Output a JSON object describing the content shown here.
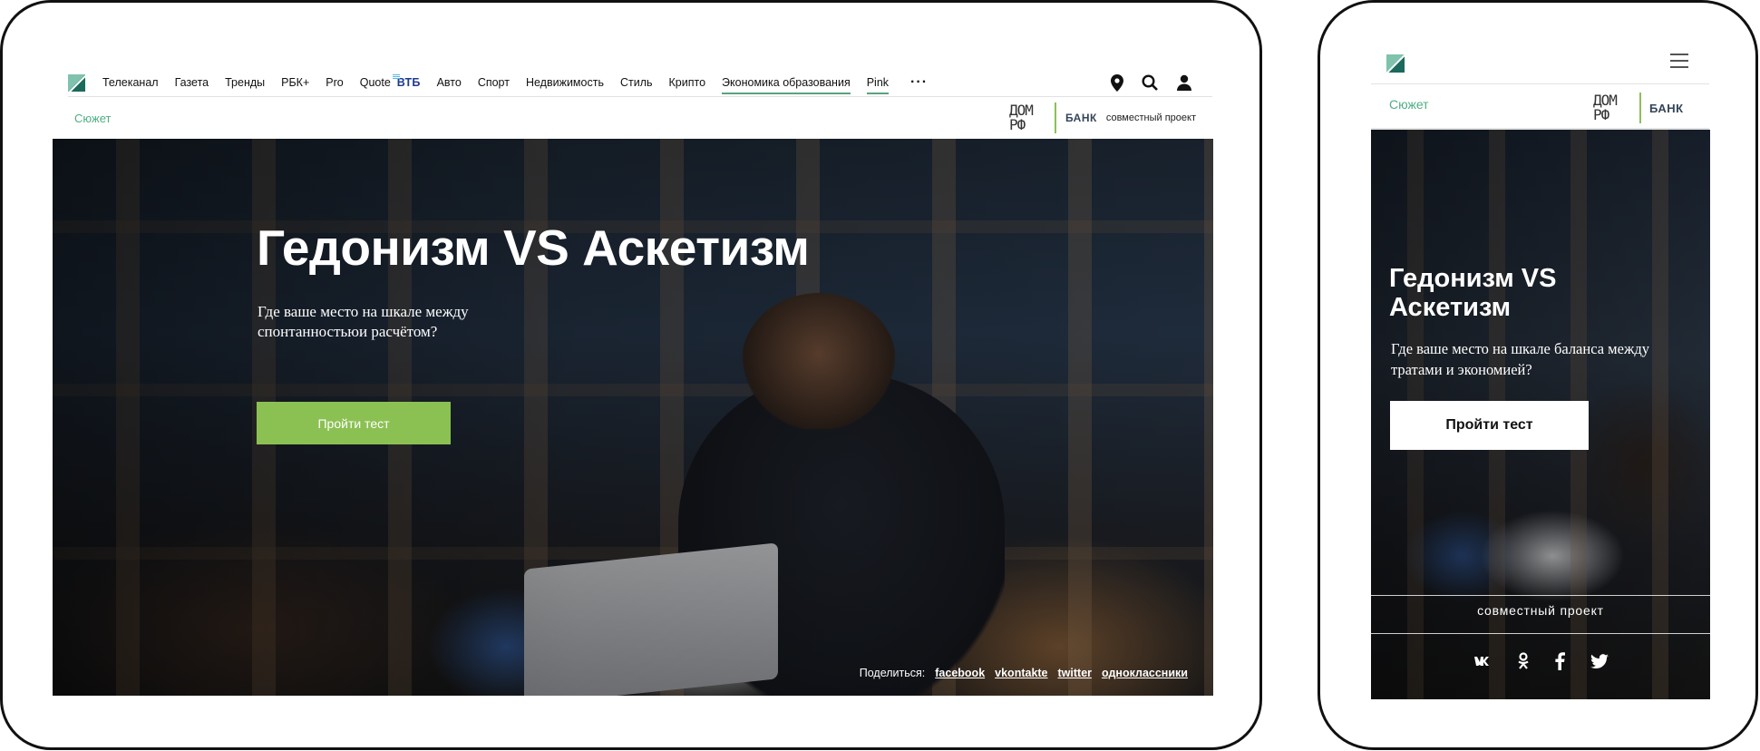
{
  "desktop": {
    "nav": {
      "items": [
        {
          "label": "Телеканал"
        },
        {
          "label": "Газета"
        },
        {
          "label": "Тренды"
        },
        {
          "label": "РБК+"
        },
        {
          "label": "Pro"
        },
        {
          "label": "Quote",
          "badge": "ВТБ"
        },
        {
          "label": "Авто"
        },
        {
          "label": "Спорт"
        },
        {
          "label": "Недвижимость"
        },
        {
          "label": "Стиль"
        },
        {
          "label": "Крипто"
        },
        {
          "label": "Экономика образования",
          "underlined": true
        },
        {
          "label": "Pink",
          "underlined": true
        }
      ],
      "more_label": "···",
      "icons": [
        "location-pin-icon",
        "search-icon",
        "user-icon"
      ]
    },
    "subbar": {
      "plot_label": "Сюжет",
      "partner_logo_line1": "ДОМ",
      "partner_logo_line2": "РФ",
      "bank_label": "БАНК",
      "joint_project": "совместный проект"
    },
    "hero": {
      "title": "Гедонизм VS Аскетизм",
      "subtitle": "Где ваше место на шкале между спонтанностьюи расчётом?",
      "cta_label": "Пройти тест",
      "share_label": "Поделиться:",
      "share_links": [
        "facebook",
        "vkontakte",
        "twitter",
        "одноклассники"
      ]
    }
  },
  "mobile": {
    "plot_label": "Сюжет",
    "partner_logo_line1": "ДОМ",
    "partner_logo_line2": "РФ",
    "bank_label": "БАНК",
    "hero": {
      "title": "Гедонизм VS Аскетизм",
      "subtitle": "Где ваше место на шкале баланса между тратами и экономией?",
      "cta_label": "Пройти тест",
      "joint_project": "совместный проект",
      "social_icons": [
        "vk-icon",
        "odnoklassniki-icon",
        "facebook-icon",
        "twitter-icon"
      ]
    }
  },
  "colors": {
    "accent_green": "#8bc152",
    "link_green": "#4fae84",
    "vtb_blue": "#1f3a8f",
    "device_border": "#111111"
  }
}
